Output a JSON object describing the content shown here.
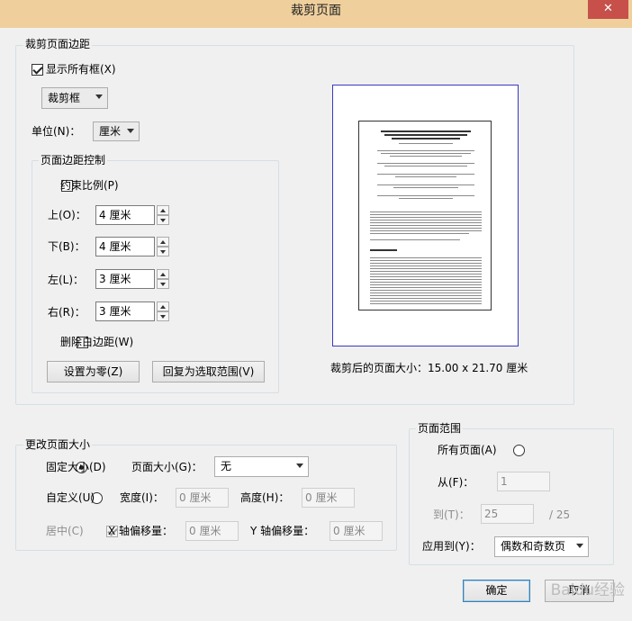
{
  "window": {
    "title": "裁剪页面",
    "close_glyph": "✕"
  },
  "crop_margins": {
    "legend": "裁剪页面边距",
    "show_all_boxes_label": "显示所有框(X)",
    "show_all_boxes_checked": true,
    "box_type_selected": "裁剪框",
    "unit_label": "单位(N)：",
    "unit_selected": "厘米",
    "margin_control": {
      "legend": "页面边距控制",
      "constrain_label": "约束比例(P)",
      "constrain_checked": false,
      "top_label": "上(O)：",
      "top_value": "4 厘米",
      "bottom_label": "下(B)：",
      "bottom_value": "4 厘米",
      "left_label": "左(L)：",
      "left_value": "3 厘米",
      "right_label": "右(R)：",
      "right_value": "3 厘米",
      "remove_white_label": "删除白边距(W)",
      "remove_white_checked": false,
      "set_zero_button": "设置为零(Z)",
      "revert_button": "回复为选取范围(V)"
    },
    "cropped_size_text": "裁剪后的页面大小：15.00 x 21.70 厘米"
  },
  "page_size": {
    "legend": "更改页面大小",
    "fixed_label": "固定大小(D)",
    "fixed_checked": true,
    "page_size_label": "页面大小(G)：",
    "page_size_selected": "无",
    "custom_label": "自定义(U)",
    "custom_checked": false,
    "width_label": "宽度(I)：",
    "width_value": "0 厘米",
    "height_label": "高度(H)：",
    "height_value": "0 厘米",
    "center_label": "居中(C)",
    "center_checked": true,
    "x_offset_label": "X 轴偏移量：",
    "x_offset_value": "0 厘米",
    "y_offset_label": "Y 轴偏移量：",
    "y_offset_value": "0 厘米"
  },
  "page_range": {
    "legend": "页面范围",
    "all_pages_label": "所有页面(A)",
    "all_pages_checked": false,
    "from_label": "从(F)：",
    "from_checked": true,
    "from_value": "1",
    "to_label": "到(T)：",
    "to_value": "25",
    "total_pages": "/ 25",
    "apply_to_label": "应用到(Y)：",
    "apply_to_selected": "偶数和奇数页"
  },
  "buttons": {
    "ok": "确定",
    "cancel": "取消"
  },
  "watermark_text": "Baidu经验"
}
